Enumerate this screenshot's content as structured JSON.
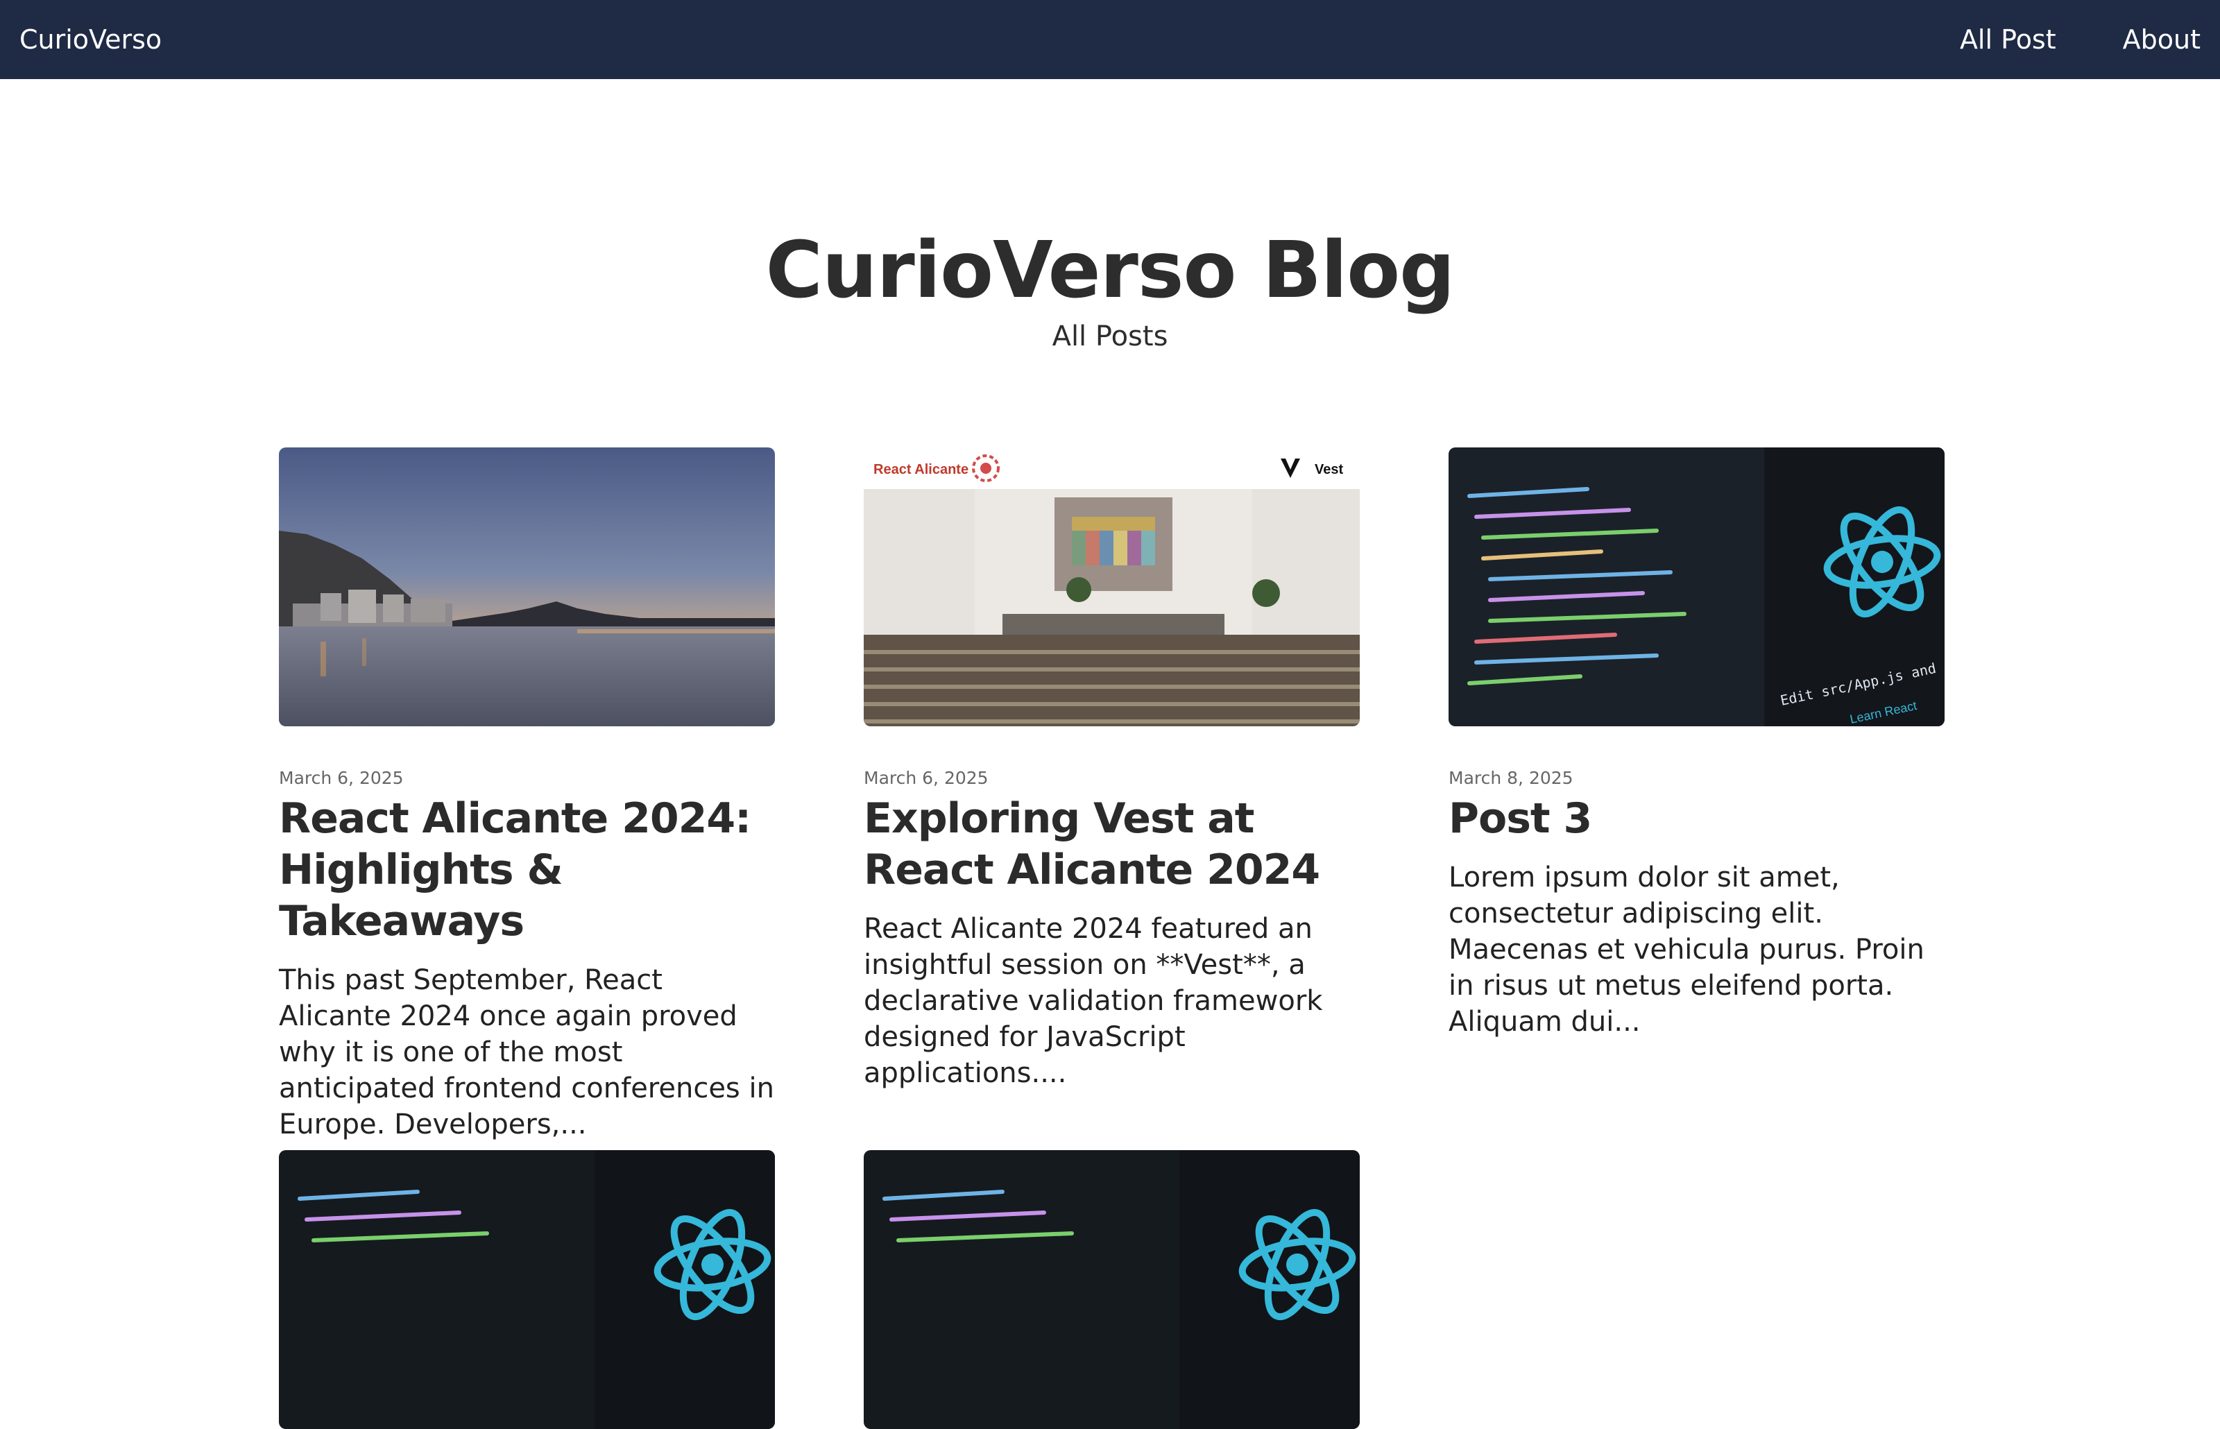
{
  "nav": {
    "brand": "CurioVerso",
    "links": [
      "All Post",
      "About"
    ]
  },
  "hero": {
    "title": "CurioVerso Blog",
    "subtitle": "All Posts"
  },
  "posts": [
    {
      "date": "March 6, 2025",
      "title": "React Alicante 2024: Highlights & Takeaways",
      "excerpt": "This past September, React Alicante 2024 once again proved why it is one of the most anticipated frontend conferences in Europe. Developers,..."
    },
    {
      "date": "March 6, 2025",
      "title": "Exploring Vest at React Alicante 2024",
      "excerpt": "React Alicante 2024 featured an insightful session on **Vest**, a declarative validation framework designed for JavaScript applications....",
      "image_text": {
        "left_logo": "React Alicante",
        "right_logo": "Vest"
      }
    },
    {
      "date": "March 8, 2025",
      "title": "Post 3",
      "excerpt": "Lorem ipsum dolor sit amet, consectetur adipiscing elit. Maecenas et vehicula purus. Proin in risus ut metus eleifend porta. Aliquam dui...",
      "image_text": {
        "editor_hint": "Edit src/App.js and save to rel",
        "link": "Learn React"
      }
    },
    {},
    {}
  ],
  "colors": {
    "navbar": "#1f2a44",
    "react_cyan": "#35b8d9",
    "text": "#2b2b2b"
  }
}
